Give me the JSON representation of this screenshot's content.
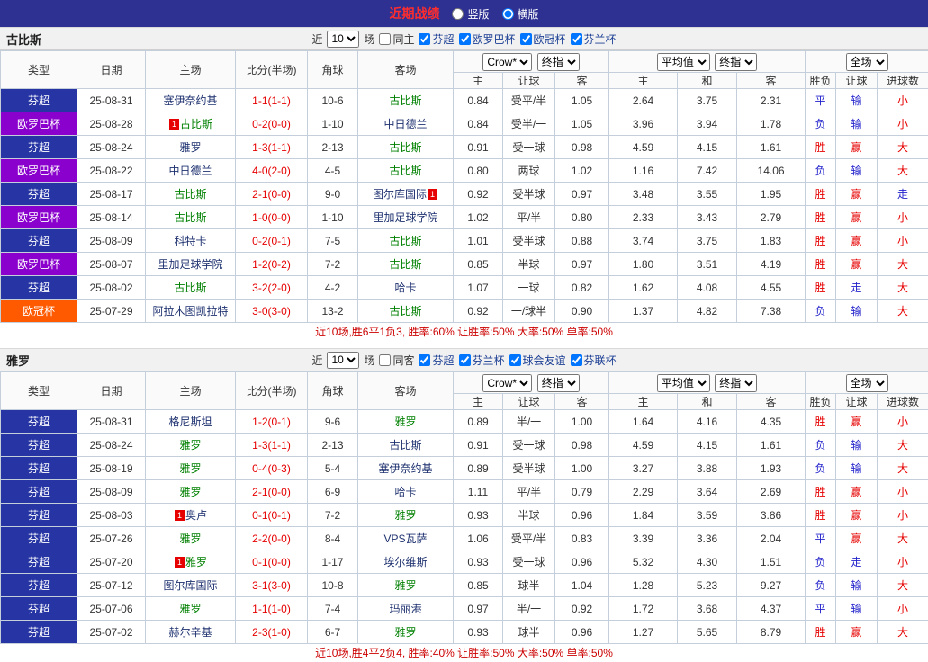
{
  "topbar": {
    "title": "近期战绩",
    "vertical": "竖版",
    "horizontal": "横版"
  },
  "columns": {
    "type": "类型",
    "date": "日期",
    "home": "主场",
    "score": "比分(半场)",
    "corner": "角球",
    "away": "客场",
    "bookmaker": "Crow*",
    "final": "终指",
    "average": "平均值",
    "fulltime": "全场",
    "sub": [
      "主",
      "让球",
      "客",
      "主",
      "和",
      "客",
      "胜负",
      "让球",
      "进球数"
    ]
  },
  "colors": {
    "league": {
      "芬超": "#2634a4",
      "欧罗巴杯": "#8a00cc",
      "欧冠杯": "#ff5a00"
    },
    "result": {
      "red": "#e60000",
      "blue": "#2323cc"
    },
    "team": {
      "focus": "#008000",
      "normal": "#1f3270"
    },
    "score": "#e60000"
  },
  "sections": [
    {
      "team": "古比斯",
      "filter": {
        "near": "近",
        "count": "10",
        "games": "场",
        "same": "同主",
        "leagues": [
          "芬超",
          "欧罗巴杯",
          "欧冠杯",
          "芬兰杯"
        ]
      },
      "rows": [
        {
          "league": "芬超",
          "date": "25-08-31",
          "home": {
            "name": "塞伊奈约基",
            "focus": false
          },
          "score": "1-1(1-1)",
          "corner": "10-6",
          "away": {
            "name": "古比斯",
            "focus": true
          },
          "odds": [
            "0.84",
            "受平/半",
            "1.05"
          ],
          "avg": [
            "2.64",
            "3.75",
            "2.31"
          ],
          "result": [
            [
              "平",
              "blue"
            ],
            [
              "输",
              "blue"
            ],
            [
              "小",
              "red"
            ]
          ]
        },
        {
          "league": "欧罗巴杯",
          "date": "25-08-28",
          "home": {
            "name": "古比斯",
            "focus": true,
            "badge": "1",
            "badge_pos": "before"
          },
          "score": "0-2(0-0)",
          "corner": "1-10",
          "away": {
            "name": "中日德兰",
            "focus": false
          },
          "odds": [
            "0.84",
            "受半/一",
            "1.05"
          ],
          "avg": [
            "3.96",
            "3.94",
            "1.78"
          ],
          "result": [
            [
              "负",
              "blue"
            ],
            [
              "输",
              "blue"
            ],
            [
              "小",
              "red"
            ]
          ]
        },
        {
          "league": "芬超",
          "date": "25-08-24",
          "home": {
            "name": "雅罗",
            "focus": false
          },
          "score": "1-3(1-1)",
          "corner": "2-13",
          "away": {
            "name": "古比斯",
            "focus": true
          },
          "odds": [
            "0.91",
            "受一球",
            "0.98"
          ],
          "avg": [
            "4.59",
            "4.15",
            "1.61"
          ],
          "result": [
            [
              "胜",
              "red"
            ],
            [
              "赢",
              "red"
            ],
            [
              "大",
              "red"
            ]
          ]
        },
        {
          "league": "欧罗巴杯",
          "date": "25-08-22",
          "home": {
            "name": "中日德兰",
            "focus": false
          },
          "score": "4-0(2-0)",
          "corner": "4-5",
          "away": {
            "name": "古比斯",
            "focus": true
          },
          "odds": [
            "0.80",
            "两球",
            "1.02"
          ],
          "avg": [
            "1.16",
            "7.42",
            "14.06"
          ],
          "result": [
            [
              "负",
              "blue"
            ],
            [
              "输",
              "blue"
            ],
            [
              "大",
              "red"
            ]
          ]
        },
        {
          "league": "芬超",
          "date": "25-08-17",
          "home": {
            "name": "古比斯",
            "focus": true
          },
          "score": "2-1(0-0)",
          "corner": "9-0",
          "away": {
            "name": "图尔库国际",
            "focus": false,
            "badge": "1",
            "badge_pos": "after"
          },
          "odds": [
            "0.92",
            "受半球",
            "0.97"
          ],
          "avg": [
            "3.48",
            "3.55",
            "1.95"
          ],
          "result": [
            [
              "胜",
              "red"
            ],
            [
              "赢",
              "red"
            ],
            [
              "走",
              "blue"
            ]
          ]
        },
        {
          "league": "欧罗巴杯",
          "date": "25-08-14",
          "home": {
            "name": "古比斯",
            "focus": true
          },
          "score": "1-0(0-0)",
          "corner": "1-10",
          "away": {
            "name": "里加足球学院",
            "focus": false
          },
          "odds": [
            "1.02",
            "平/半",
            "0.80"
          ],
          "avg": [
            "2.33",
            "3.43",
            "2.79"
          ],
          "result": [
            [
              "胜",
              "red"
            ],
            [
              "赢",
              "red"
            ],
            [
              "小",
              "red"
            ]
          ]
        },
        {
          "league": "芬超",
          "date": "25-08-09",
          "home": {
            "name": "科特卡",
            "focus": false
          },
          "score": "0-2(0-1)",
          "corner": "7-5",
          "away": {
            "name": "古比斯",
            "focus": true
          },
          "odds": [
            "1.01",
            "受半球",
            "0.88"
          ],
          "avg": [
            "3.74",
            "3.75",
            "1.83"
          ],
          "result": [
            [
              "胜",
              "red"
            ],
            [
              "赢",
              "red"
            ],
            [
              "小",
              "red"
            ]
          ]
        },
        {
          "league": "欧罗巴杯",
          "date": "25-08-07",
          "home": {
            "name": "里加足球学院",
            "focus": false
          },
          "score": "1-2(0-2)",
          "corner": "7-2",
          "away": {
            "name": "古比斯",
            "focus": true
          },
          "odds": [
            "0.85",
            "半球",
            "0.97"
          ],
          "avg": [
            "1.80",
            "3.51",
            "4.19"
          ],
          "result": [
            [
              "胜",
              "red"
            ],
            [
              "赢",
              "red"
            ],
            [
              "大",
              "red"
            ]
          ]
        },
        {
          "league": "芬超",
          "date": "25-08-02",
          "home": {
            "name": "古比斯",
            "focus": true
          },
          "score": "3-2(2-0)",
          "corner": "4-2",
          "away": {
            "name": "哈卡",
            "focus": false
          },
          "odds": [
            "1.07",
            "一球",
            "0.82"
          ],
          "avg": [
            "1.62",
            "4.08",
            "4.55"
          ],
          "result": [
            [
              "胜",
              "red"
            ],
            [
              "走",
              "blue"
            ],
            [
              "大",
              "red"
            ]
          ]
        },
        {
          "league": "欧冠杯",
          "date": "25-07-29",
          "home": {
            "name": "阿拉木图凯拉特",
            "focus": false
          },
          "score": "3-0(3-0)",
          "corner": "13-2",
          "away": {
            "name": "古比斯",
            "focus": true
          },
          "odds": [
            "0.92",
            "一/球半",
            "0.90"
          ],
          "avg": [
            "1.37",
            "4.82",
            "7.38"
          ],
          "result": [
            [
              "负",
              "blue"
            ],
            [
              "输",
              "blue"
            ],
            [
              "大",
              "red"
            ]
          ]
        }
      ],
      "summary": "近10场,胜6平1负3, 胜率:60% 让胜率:50% 大率:50% 单率:50%"
    },
    {
      "team": "雅罗",
      "filter": {
        "near": "近",
        "count": "10",
        "games": "场",
        "same": "同客",
        "leagues": [
          "芬超",
          "芬兰杯",
          "球会友谊",
          "芬联杯"
        ]
      },
      "rows": [
        {
          "league": "芬超",
          "date": "25-08-31",
          "home": {
            "name": "格尼斯坦",
            "focus": false
          },
          "score": "1-2(0-1)",
          "corner": "9-6",
          "away": {
            "name": "雅罗",
            "focus": true
          },
          "odds": [
            "0.89",
            "半/一",
            "1.00"
          ],
          "avg": [
            "1.64",
            "4.16",
            "4.35"
          ],
          "result": [
            [
              "胜",
              "red"
            ],
            [
              "赢",
              "red"
            ],
            [
              "小",
              "red"
            ]
          ]
        },
        {
          "league": "芬超",
          "date": "25-08-24",
          "home": {
            "name": "雅罗",
            "focus": true
          },
          "score": "1-3(1-1)",
          "corner": "2-13",
          "away": {
            "name": "古比斯",
            "focus": false
          },
          "odds": [
            "0.91",
            "受一球",
            "0.98"
          ],
          "avg": [
            "4.59",
            "4.15",
            "1.61"
          ],
          "result": [
            [
              "负",
              "blue"
            ],
            [
              "输",
              "blue"
            ],
            [
              "大",
              "red"
            ]
          ]
        },
        {
          "league": "芬超",
          "date": "25-08-19",
          "home": {
            "name": "雅罗",
            "focus": true
          },
          "score": "0-4(0-3)",
          "corner": "5-4",
          "away": {
            "name": "塞伊奈约基",
            "focus": false
          },
          "odds": [
            "0.89",
            "受半球",
            "1.00"
          ],
          "avg": [
            "3.27",
            "3.88",
            "1.93"
          ],
          "result": [
            [
              "负",
              "blue"
            ],
            [
              "输",
              "blue"
            ],
            [
              "大",
              "red"
            ]
          ]
        },
        {
          "league": "芬超",
          "date": "25-08-09",
          "home": {
            "name": "雅罗",
            "focus": true
          },
          "score": "2-1(0-0)",
          "corner": "6-9",
          "away": {
            "name": "哈卡",
            "focus": false
          },
          "odds": [
            "1.11",
            "平/半",
            "0.79"
          ],
          "avg": [
            "2.29",
            "3.64",
            "2.69"
          ],
          "result": [
            [
              "胜",
              "red"
            ],
            [
              "赢",
              "red"
            ],
            [
              "小",
              "red"
            ]
          ]
        },
        {
          "league": "芬超",
          "date": "25-08-03",
          "home": {
            "name": "奥卢",
            "focus": false,
            "badge": "1",
            "badge_pos": "before"
          },
          "score": "0-1(0-1)",
          "corner": "7-2",
          "away": {
            "name": "雅罗",
            "focus": true
          },
          "odds": [
            "0.93",
            "半球",
            "0.96"
          ],
          "avg": [
            "1.84",
            "3.59",
            "3.86"
          ],
          "result": [
            [
              "胜",
              "red"
            ],
            [
              "赢",
              "red"
            ],
            [
              "小",
              "red"
            ]
          ]
        },
        {
          "league": "芬超",
          "date": "25-07-26",
          "home": {
            "name": "雅罗",
            "focus": true
          },
          "score": "2-2(0-0)",
          "corner": "8-4",
          "away": {
            "name": "VPS瓦萨",
            "focus": false
          },
          "odds": [
            "1.06",
            "受平/半",
            "0.83"
          ],
          "avg": [
            "3.39",
            "3.36",
            "2.04"
          ],
          "result": [
            [
              "平",
              "blue"
            ],
            [
              "赢",
              "red"
            ],
            [
              "大",
              "red"
            ]
          ]
        },
        {
          "league": "芬超",
          "date": "25-07-20",
          "home": {
            "name": "雅罗",
            "focus": true,
            "badge": "1",
            "badge_pos": "before"
          },
          "score": "0-1(0-0)",
          "corner": "1-17",
          "away": {
            "name": "埃尔维斯",
            "focus": false
          },
          "odds": [
            "0.93",
            "受一球",
            "0.96"
          ],
          "avg": [
            "5.32",
            "4.30",
            "1.51"
          ],
          "result": [
            [
              "负",
              "blue"
            ],
            [
              "走",
              "blue"
            ],
            [
              "小",
              "red"
            ]
          ]
        },
        {
          "league": "芬超",
          "date": "25-07-12",
          "home": {
            "name": "图尔库国际",
            "focus": false
          },
          "score": "3-1(3-0)",
          "corner": "10-8",
          "away": {
            "name": "雅罗",
            "focus": true
          },
          "odds": [
            "0.85",
            "球半",
            "1.04"
          ],
          "avg": [
            "1.28",
            "5.23",
            "9.27"
          ],
          "result": [
            [
              "负",
              "blue"
            ],
            [
              "输",
              "blue"
            ],
            [
              "大",
              "red"
            ]
          ]
        },
        {
          "league": "芬超",
          "date": "25-07-06",
          "home": {
            "name": "雅罗",
            "focus": true
          },
          "score": "1-1(1-0)",
          "corner": "7-4",
          "away": {
            "name": "玛丽港",
            "focus": false
          },
          "odds": [
            "0.97",
            "半/一",
            "0.92"
          ],
          "avg": [
            "1.72",
            "3.68",
            "4.37"
          ],
          "result": [
            [
              "平",
              "blue"
            ],
            [
              "输",
              "blue"
            ],
            [
              "小",
              "red"
            ]
          ]
        },
        {
          "league": "芬超",
          "date": "25-07-02",
          "home": {
            "name": "赫尔辛基",
            "focus": false
          },
          "score": "2-3(1-0)",
          "corner": "6-7",
          "away": {
            "name": "雅罗",
            "focus": true
          },
          "odds": [
            "0.93",
            "球半",
            "0.96"
          ],
          "avg": [
            "1.27",
            "5.65",
            "8.79"
          ],
          "result": [
            [
              "胜",
              "red"
            ],
            [
              "赢",
              "red"
            ],
            [
              "大",
              "red"
            ]
          ]
        }
      ],
      "summary": "近10场,胜4平2负4, 胜率:40% 让胜率:50% 大率:50% 单率:50%"
    }
  ]
}
